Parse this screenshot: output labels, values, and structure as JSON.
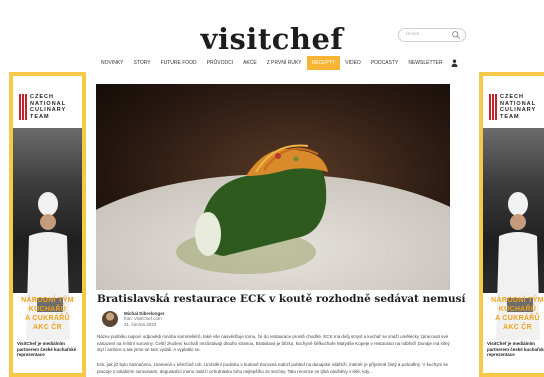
{
  "site": {
    "logo": "visitchef",
    "search_placeholder": "Hledat..."
  },
  "nav": {
    "items": [
      {
        "label": "Novinky",
        "active": false
      },
      {
        "label": "Story",
        "active": false
      },
      {
        "label": "Future Food",
        "active": false
      },
      {
        "label": "Průvodci",
        "active": false
      },
      {
        "label": "Akce",
        "active": false
      },
      {
        "label": "Z první ruky",
        "active": false
      },
      {
        "label": "Recepty",
        "active": true
      },
      {
        "label": "Video",
        "active": false
      },
      {
        "label": "Podcasty",
        "active": false
      },
      {
        "label": "Newsletter",
        "active": false
      }
    ],
    "user_icon": "user-icon",
    "accent": "#f7b533"
  },
  "ad": {
    "logo_lines": [
      "CZECH",
      "NATIONAL",
      "CULINARY",
      "TEAM"
    ],
    "headline_lines": [
      "NÁRODNÍ TÝM",
      "KUCHAŘŮ",
      "A CUKRÁŘŮ",
      "AKC ČR"
    ],
    "body": "VisitChef je mediálním partnerem české kuchařské reprezentace",
    "border_color": "#f7c948",
    "headline_color": "#f0a21c"
  },
  "article": {
    "title": "Bratislavská restaurace ECK v koutě rozhodně sedávat nemusí",
    "author": "Michal Dibrelonger",
    "role": "foto: VisitChef.com",
    "date": "21. června 2023",
    "paragraphs": [
      "Název podniku napoví odpovědi mnoha sommeliérů, také vše nasvědčuje tomu, že do restaurace prostě chodíte. ECK má dvůj smysl a kuchař se snaží umělecky zpracovat své nasazení na místní suroviny. Čeští zkušení kuchaři nezůstávají dlouho stranou, Bratislava je blízko, kuchyně šéfkuchaře Matyáše Kopeje v restauraci na nábřeží Dunaje má silný styl i ambice a tak jsme se tam vydali. A vyplatilo se.",
      "Eck, jak již bylo naznačeno, znamená v němčině roh. Umístění podniku v budově Eurovea nabízí pohled na dunajské nábřeží, interiér je příjemně čistý a pohodlný. V kuchyni se pracuje s lokálními surovinami, degustační menu nabízí ochutnávku toho nejlepšího ze sezóny. Tato recenze se týká návštěvy v létě, kdy..."
    ]
  }
}
